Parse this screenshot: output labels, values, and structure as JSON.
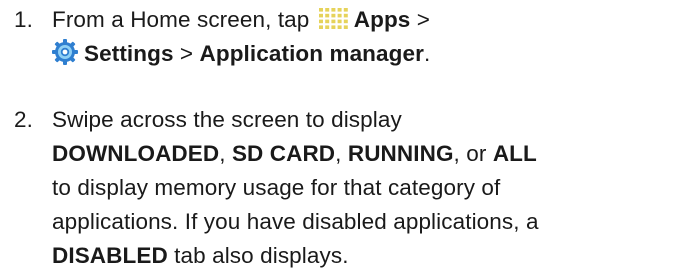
{
  "steps": [
    {
      "number": "1.",
      "line1_prefix": "From a Home screen, tap",
      "apps_label": "Apps",
      "separator_a": " >",
      "settings_label": "Settings",
      "separator_b": " > ",
      "app_manager_label": "Application manager",
      "end_period": ".",
      "apps_icon": "apps-grid-icon",
      "settings_icon": "settings-gear-icon"
    },
    {
      "number": "2.",
      "text_intro": "Swipe across the screen to display",
      "downloaded": "DOWNLOADED",
      "comma_1": ", ",
      "sd_card": "SD CARD",
      "comma_2": ", ",
      "running": "RUNNING",
      "or": ", or ",
      "all": "ALL",
      "text_mid": "to display memory usage for that category of applications. If you have disabled applications, a",
      "disabled": "DISABLED",
      "text_end": " tab also displays."
    }
  ],
  "colors": {
    "text": "#1a1a1a",
    "apps_icon": "#e6d35a",
    "settings_icon_outer": "#2f7fd0",
    "settings_icon_inner": "#8fd0f5"
  }
}
